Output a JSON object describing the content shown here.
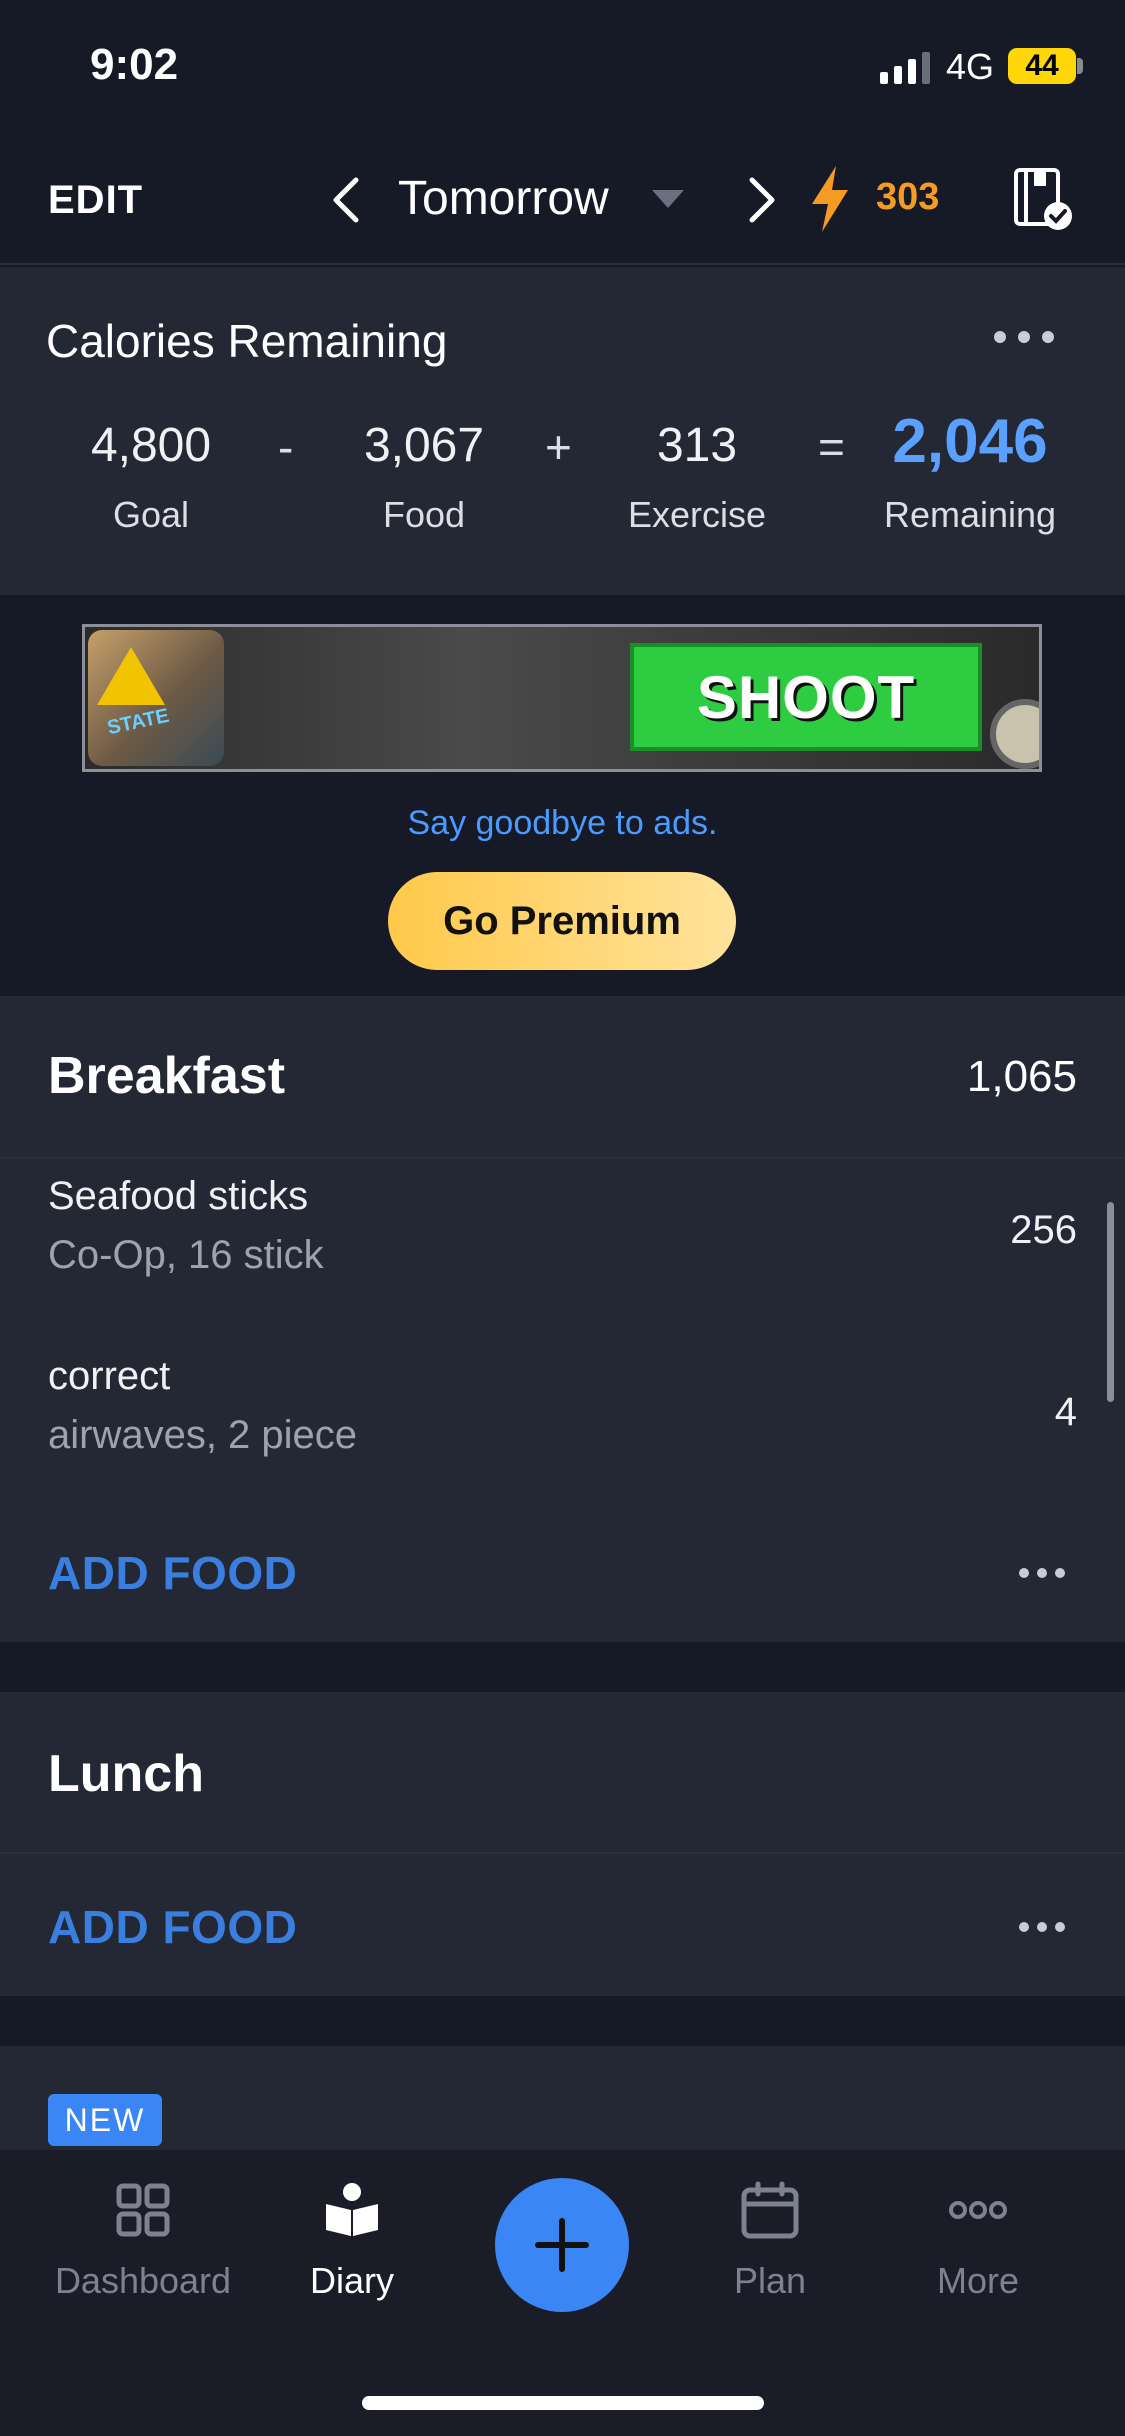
{
  "status_bar": {
    "time": "9:02",
    "network": "4G",
    "battery": "44"
  },
  "header": {
    "edit_label": "EDIT",
    "date_label": "Tomorrow",
    "streak_count": "303",
    "icons": {
      "prev": "chevron-left-icon",
      "next": "chevron-right-icon",
      "streak": "lightning-bolt-icon",
      "journal": "food-journal-check-icon"
    }
  },
  "calories": {
    "title": "Calories Remaining",
    "goal": {
      "value": "4,800",
      "label": "Goal"
    },
    "food": {
      "value": "3,067",
      "label": "Food"
    },
    "exercise": {
      "value": "313",
      "label": "Exercise"
    },
    "remaining": {
      "value": "2,046",
      "label": "Remaining"
    },
    "operators": {
      "minus": "-",
      "plus": "+",
      "equals": "="
    }
  },
  "ad": {
    "button_text": "SHOOT",
    "thumb_text": "STATE",
    "goodbye_text": "Say goodbye to ads.",
    "premium_label": "Go Premium"
  },
  "breakfast": {
    "title": "Breakfast",
    "total": "1,065",
    "items": [
      {
        "name": "Seafood sticks",
        "detail": "Co-Op, 16 stick",
        "calories": "256"
      },
      {
        "name": "correct",
        "detail": "airwaves, 2 piece",
        "calories": "4"
      }
    ],
    "add_label": "ADD FOOD"
  },
  "lunch": {
    "title": "Lunch",
    "add_label": "ADD FOOD"
  },
  "new_badge": "NEW",
  "tabs": [
    {
      "label": "Dashboard",
      "icon": "dashboard-grid-icon",
      "active": false
    },
    {
      "label": "Diary",
      "icon": "diary-book-icon",
      "active": true
    },
    {
      "label": "Plan",
      "icon": "calendar-icon",
      "active": false
    },
    {
      "label": "More",
      "icon": "more-dots-icon",
      "active": false
    }
  ],
  "colors": {
    "accent_blue": "#3b86f5",
    "remaining_blue": "#5aa0ff",
    "streak_orange": "#f59a23",
    "premium_yellow": "#ffc94a"
  }
}
